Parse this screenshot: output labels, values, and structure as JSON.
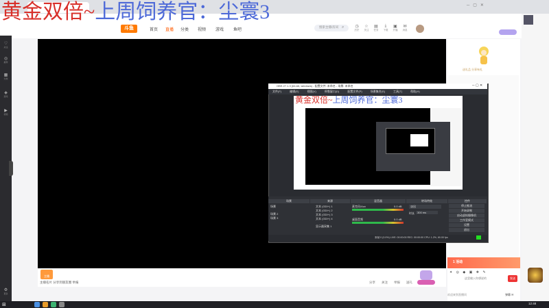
{
  "overlay": {
    "title_red": "黄金双倍~",
    "title_blue": "上周饲养官：尘寰3"
  },
  "site": {
    "logo": "斗鱼",
    "nav": [
      "首页",
      "直播",
      "分类",
      "视频",
      "游戏",
      "鱼吧"
    ],
    "active_nav": "直播",
    "search_placeholder": "搜索主播/房间",
    "header_icons": [
      "历史",
      "关注",
      "任务",
      "下载",
      "开播",
      "消息"
    ]
  },
  "sidebar": {
    "items": [
      "关注",
      "推荐",
      "分类",
      "游戏",
      "视频"
    ],
    "bottom": "更多"
  },
  "player": {
    "streamer_badge": "主播",
    "streamer_sub": "主播名片 分享到朋友圈 举报",
    "actions": [
      "分享",
      "关注",
      "举报",
      "送礼"
    ]
  },
  "rightcol": {
    "ad_caption": "送礼品 分享有礼",
    "promo_text": "1 活动",
    "promo_icons": "✦ ◎ ◆ ▣ ❖ ✎",
    "promo_input": "这里输入你想说的",
    "promo_send": "发送",
    "chat_input": "欢迎来到直播间",
    "chat_go": "弹幕 ✉"
  },
  "obs": {
    "title": "OBS 27.1.3 (64-bit, windows) - 配置文件: 未命名 - 场景: 未命名",
    "menus": [
      "文件(F)",
      "编辑(E)",
      "视图(V)",
      "停靠窗口(D)",
      "配置文件(P)",
      "场景集合(S)",
      "工具(T)",
      "帮助(H)"
    ],
    "preview_title_red": "黄金双倍~",
    "preview_title_blue": "上周饲养官：尘寰3",
    "docks": {
      "scenes_header": "场景",
      "sources_header": "来源",
      "mixer_header": "混音器",
      "transitions_header": "转场特效",
      "controls_header": "控件",
      "scene_items": [
        "场景",
        "场景 2",
        "场景 3"
      ],
      "source_items": [
        "文本 (GDI+) 1",
        "文本 (GDI+) 2",
        "文本 (GDI+) 3",
        "文本 (GDI+) 4",
        "显示器采集 1"
      ],
      "mixer_items": [
        "麦克风/Aux",
        "桌面音频"
      ],
      "mixer_db": [
        "0.0 dB",
        "0.0 dB"
      ],
      "transition_type": "淡出",
      "transition_duration_label": "时长",
      "transition_duration": "300 ms",
      "controls": [
        "停止推流",
        "开始录制",
        "启动虚拟摄像机",
        "工作室模式",
        "设置",
        "退出"
      ]
    },
    "status": "丢帧 0 (0.0%)  LIVE: 00:00:00  REC: 00:00:00  CPU: 1.2%, 60.00 fps"
  },
  "taskbar": {
    "time": "12:48"
  }
}
